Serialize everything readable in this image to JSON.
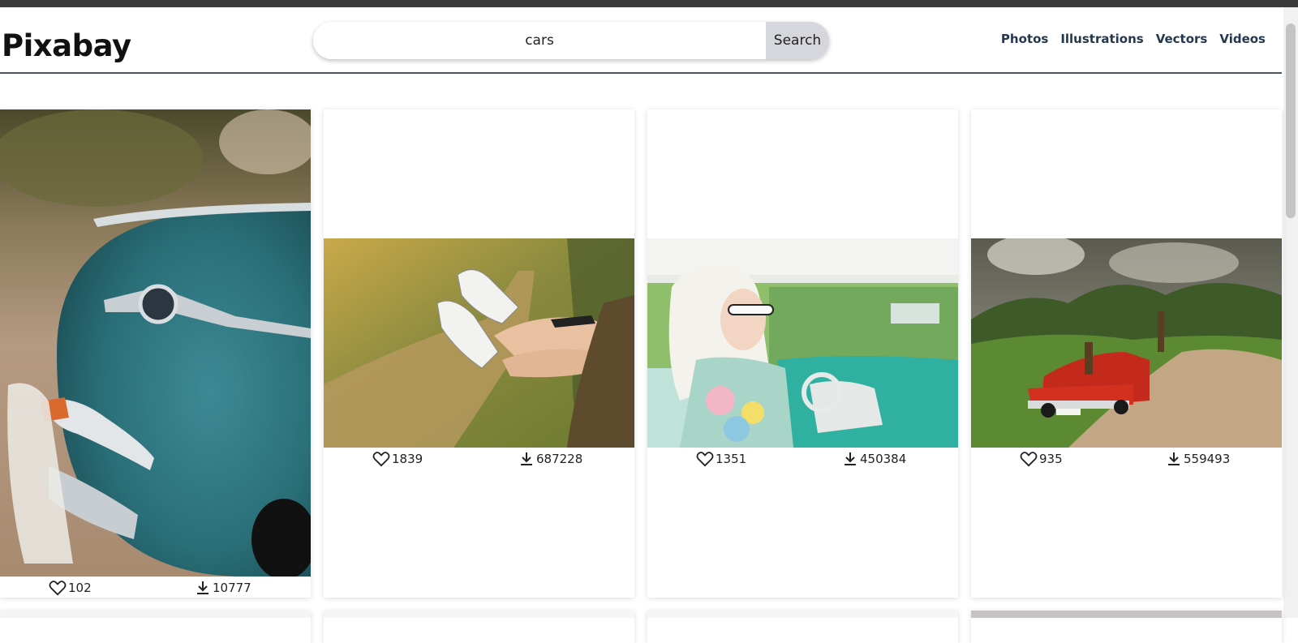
{
  "header": {
    "logo": "Pixabay",
    "search": {
      "value": "cars",
      "button_label": "Search"
    },
    "nav": [
      "Photos",
      "Illustrations",
      "Vectors",
      "Videos"
    ]
  },
  "results": [
    {
      "subject": "teal vintage car fender with chrome emblem",
      "likes": "102",
      "downloads": "10777"
    },
    {
      "subject": "feet in white sneakers out of car window",
      "likes": "1839",
      "downloads": "687228"
    },
    {
      "subject": "woman in headscarf and sunglasses in turquoise car",
      "likes": "1351",
      "downloads": "450384"
    },
    {
      "subject": "red vintage convertible on dirt road",
      "likes": "935",
      "downloads": "559493"
    }
  ],
  "icons": {
    "like": "heart-icon",
    "download": "download-icon"
  },
  "colors": {
    "nav_text": "#24384f",
    "search_button": "#d6d7dc",
    "divider": "#4a5568"
  }
}
